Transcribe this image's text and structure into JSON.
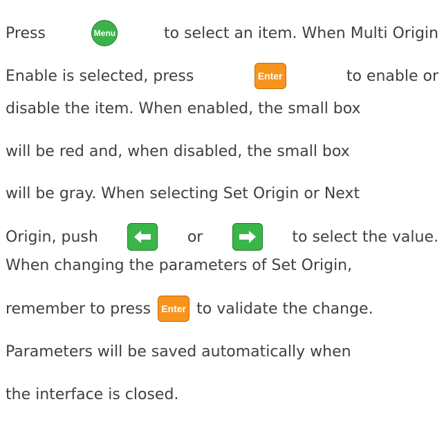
{
  "paragraph": {
    "line1": {
      "before": "Press",
      "key": "Menu",
      "after": "to select an item. When Multi Origin"
    },
    "line2": {
      "before": "Enable is selected, press",
      "key": "Enter",
      "after": "to enable or"
    },
    "line3": "disable the item. When enabled, the small box",
    "line4": "will be red and, when disabled, the small box",
    "line5": "will be gray. When selecting Set Origin or Next",
    "line6": {
      "before": "Origin, push",
      "left_key_icon": "left-arrow-icon",
      "middle": "or",
      "right_key_icon": "right-arrow-icon",
      "after": "to select the value."
    },
    "line7": "When changing the parameters of Set Origin,",
    "line8": {
      "before": "remember to press",
      "key": "Enter",
      "after": "to validate the change."
    },
    "line9": "Parameters will be saved automatically when",
    "line10": "the interface is closed."
  },
  "colors": {
    "text": "#404040",
    "menu_key": "#3cb34a",
    "enter_key": "#f7941d",
    "arrow_key": "#39b54a"
  }
}
